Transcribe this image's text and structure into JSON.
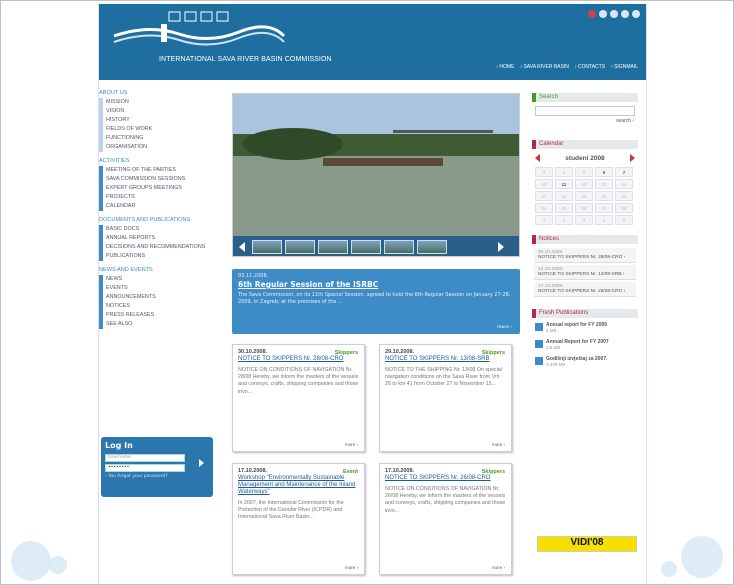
{
  "header": {
    "org_name": "INTERNATIONAL SAVA RIVER BASIN COMMISSION",
    "nav": [
      "› HOME",
      "› SAVA RIVER BASIN",
      "› CONTACTS",
      "› SIGNMAIL"
    ]
  },
  "left": {
    "about_title": "ABOUT US",
    "about": [
      "MISSION",
      "VISION",
      "HISTORY",
      "FIELDS OF WORK",
      "FUNCTIONING",
      "ORGANISATION"
    ],
    "activities_title": "ACTIVITIES",
    "activities": [
      "MEETING OF THE PARTIES",
      "SAVA COMMISSION SESSIONS",
      "EXPERT GROUPS MEETINGS",
      "PROJECTS",
      "CALENDAR"
    ],
    "docs_title": "DOCUMENTS AND PUBLICATIONS",
    "docs": [
      "BASIC DOCS",
      "ANNUAL REPORTS",
      "DECISIONS AND RECOMMENDATIONS",
      "PUBLICATIONS"
    ],
    "news_title": "NEWS AND EVENTS",
    "news": [
      "NEWS",
      "EVENTS",
      "ANNOUNCEMENTS",
      "NOTICES",
      "PRESS RELEASES",
      "SEE ALSO"
    ]
  },
  "login": {
    "title": "Log In",
    "username_placeholder": "Username",
    "password_value": "••••••••",
    "forgot": "› You forgot your password?"
  },
  "featured": {
    "date": "03.11.2008.",
    "title": "6th Regular Session of the ISRBC",
    "text": "The Sava Commission, on its 11th Special Session, agreed to hold the 6th Regular Session on January 27-28, 2009, in Zagreb, at the premises of the ...",
    "more": "more ›"
  },
  "cards": [
    {
      "date": "30.10.2008.",
      "cat": "Skippers",
      "title": "NOTICE TO SKIPPERS Nr. 28/08-CRO",
      "text": "NOTICE ON CONDITIONS OF NAVIGATION Nr. 28/08 Hereby, we inform the masters of the vessels and convoys, crafts, shipping companies and those invo...",
      "more": "more ›"
    },
    {
      "date": "29.10.2008.",
      "cat": "Skippers",
      "title": "NOTICE TO SKIPPERS Nr. 13/08-SRB",
      "text": "NOTICE TO THE SHIPPING Nr. 13/08 On special navigation conditions on the Sava River from Vrh 25 to km 41 from October 27 to November 15...",
      "more": "more ›"
    },
    {
      "date": "17.10.2008.",
      "cat": "Event",
      "title": "Workshop \"Environmentally Sustainable Management and Maintenance of the Inland Waterways\"",
      "text": "In 2007, the International Commission for the Protection of the Danube River (ICPDR) and International Sava River Basin...",
      "more": "more ›"
    },
    {
      "date": "17.10.2008.",
      "cat": "Skippers",
      "title": "NOTICE TO SKIPPERS Nr. 26/08-CRO",
      "text": "NOTICE ON CONDITIONS OF NAVIGATION Nr. 26/08 Hereby, we inform the masters of the vessels and convoys, crafts, shipping companies and those invo...",
      "more": "more ›"
    }
  ],
  "search": {
    "title": "Search",
    "button": "search ›"
  },
  "calendar": {
    "title": "Calendar",
    "month": "studeni 2008",
    "days": [
      "3",
      "4",
      "5",
      "6",
      "7",
      "10",
      "11",
      "12",
      "13",
      "14",
      "17",
      "18",
      "19",
      "20",
      "21",
      "24",
      "25",
      "26",
      "27",
      "28",
      "1",
      "2",
      "3",
      "4",
      "5"
    ]
  },
  "notices": {
    "title": "Notices",
    "items": [
      {
        "date": "30.10.2008.",
        "title": "NOTICE TO SKIPPERS Nr. 28/08-CRO ›"
      },
      {
        "date": "24.10.2008.",
        "title": "NOTICE TO SKIPPERS Nr. 13/08-SRB ›"
      },
      {
        "date": "17.10.2008.",
        "title": "NOTICE TO SKIPPERS Nr. 26/08-CRO ›"
      }
    ]
  },
  "publications": {
    "title": "Fresh Publications",
    "items": [
      {
        "title": "Annual report for FY 2005",
        "size": "2 MB"
      },
      {
        "title": "Annual Report for FY 2007",
        "size": "3.8 MB"
      },
      {
        "title": "Godišnji izvještaj za 2007.",
        "size": "3.448 MB"
      }
    ]
  },
  "banner": "VIDI'08"
}
